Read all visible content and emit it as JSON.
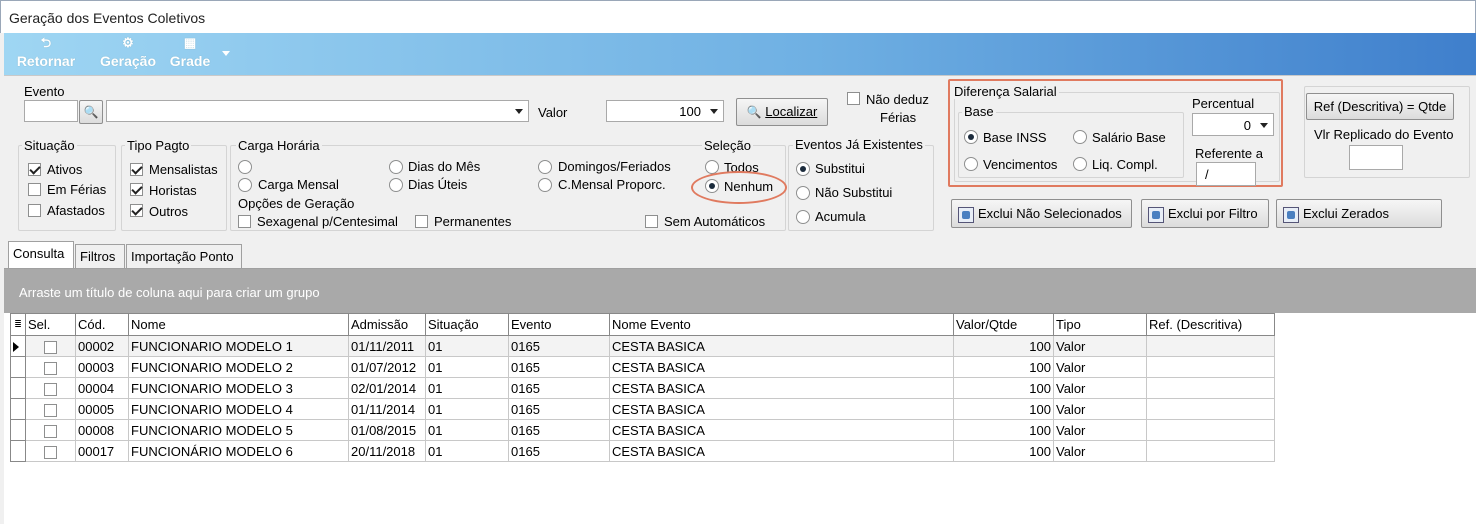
{
  "window": {
    "title": "Geração dos Eventos Coletivos"
  },
  "toolbar": {
    "retornar": "Retornar",
    "geracao": "Geração",
    "grade": "Grade"
  },
  "evento": {
    "label": "Evento",
    "code_value": "",
    "desc_value": "",
    "valor_label": "Valor",
    "valor_value": "100",
    "localizar": "Localizar",
    "nao_deduz_ferias_1": "Não deduz",
    "nao_deduz_ferias_2": "Férias"
  },
  "situacao": {
    "title": "Situação",
    "items": [
      {
        "label": "Ativos",
        "checked": true
      },
      {
        "label": "Em Férias",
        "checked": false
      },
      {
        "label": "Afastados",
        "checked": false
      }
    ]
  },
  "tipo_pagto": {
    "title": "Tipo Pagto",
    "items": [
      {
        "label": "Mensalistas",
        "checked": true
      },
      {
        "label": "Horistas",
        "checked": true
      },
      {
        "label": "Outros",
        "checked": true
      }
    ]
  },
  "carga_horaria": {
    "title": "Carga Horária",
    "options": [
      "",
      "Carga Mensal",
      "Dias do Mês",
      "Dias Úteis",
      "Domingos/Feriados",
      "C.Mensal Proporc."
    ]
  },
  "opcoes_geracao": {
    "title": "Opções de Geração",
    "sexagenal": "Sexagenal p/Centesimal",
    "permanentes": "Permanentes",
    "sem_automaticos": "Sem Automáticos"
  },
  "selecao": {
    "title": "Seleção",
    "todos": "Todos",
    "nenhum": "Nenhum",
    "selected": "Nenhum"
  },
  "eventos_existentes": {
    "title": "Eventos Já Existentes",
    "options": [
      "Substitui",
      "Não Substitui",
      "Acumula"
    ],
    "selected": "Substitui"
  },
  "diferenca_salarial": {
    "title": "Diferença Salarial",
    "base_title": "Base",
    "options": [
      "Base INSS",
      "Salário Base",
      "Vencimentos",
      "Liq. Compl."
    ],
    "selected": "Base INSS",
    "percentual_label": "Percentual",
    "percentual_value": "0",
    "referente_label": "Referente a",
    "referente_value": "/"
  },
  "right_panel": {
    "ref_button": "Ref (Descritiva) = Qtde",
    "vlr_replicado": "Vlr Replicado do  Evento"
  },
  "actions": {
    "exclui_nao_selecionados": "Exclui Não Selecionados",
    "exclui_por_filtro": "Exclui por Filtro",
    "exclui_zerados": "Exclui Zerados"
  },
  "tabs": [
    "Consulta",
    "Filtros",
    "Importação Ponto"
  ],
  "grid": {
    "group_hint": "Arraste um título de coluna aqui para criar um grupo",
    "columns": [
      "Sel.",
      "Cód.",
      "Nome",
      "Admissão",
      "Situação",
      "Evento",
      "Nome Evento",
      "Valor/Qtde",
      "Tipo",
      "Ref. (Descritiva)"
    ],
    "rows": [
      [
        "",
        "00002",
        "FUNCIONARIO MODELO 1",
        "01/11/2011",
        "01",
        "0165",
        "CESTA BASICA",
        "100",
        "Valor",
        ""
      ],
      [
        "",
        "00003",
        "FUNCIONARIO MODELO 2",
        "01/07/2012",
        "01",
        "0165",
        "CESTA BASICA",
        "100",
        "Valor",
        ""
      ],
      [
        "",
        "00004",
        "FUNCIONARIO MODELO 3",
        "02/01/2014",
        "01",
        "0165",
        "CESTA BASICA",
        "100",
        "Valor",
        ""
      ],
      [
        "",
        "00005",
        "FUNCIONARIO MODELO 4",
        "01/11/2014",
        "01",
        "0165",
        "CESTA BASICA",
        "100",
        "Valor",
        ""
      ],
      [
        "",
        "00008",
        "FUNCIONARIO MODELO 5",
        "01/08/2015",
        "01",
        "0165",
        "CESTA BASICA",
        "100",
        "Valor",
        ""
      ],
      [
        "",
        "00017",
        "FUNCIONÁRIO MODELO 6",
        "20/11/2018",
        "01",
        "0165",
        "CESTA BASICA",
        "100",
        "Valor",
        ""
      ]
    ]
  },
  "colors": {
    "highlight": "#e07a5f",
    "toolbar_start": "#9fd6f3",
    "toolbar_end": "#3f7fcc"
  }
}
